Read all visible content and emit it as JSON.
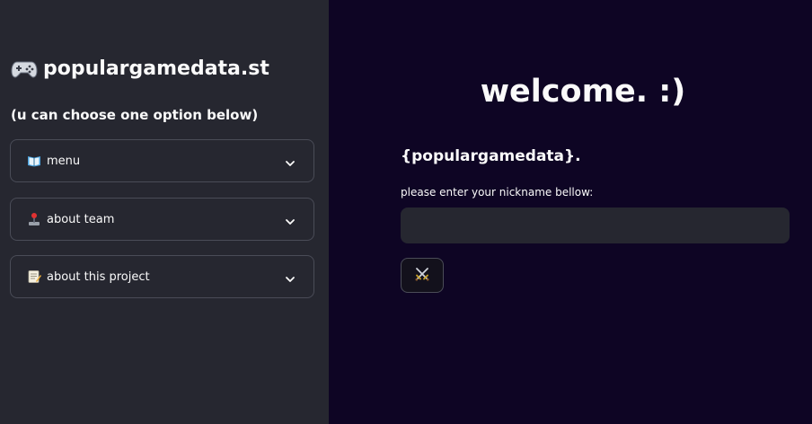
{
  "sidebar": {
    "title": "populargamedata.st",
    "title_icon": "game-controller-icon",
    "subtitle": "(u can choose one option below)",
    "expanders": [
      {
        "label": "menu",
        "icon": "book-icon"
      },
      {
        "label": "about team",
        "icon": "joystick-icon"
      },
      {
        "label": "about this project",
        "icon": "memo-icon"
      }
    ]
  },
  "main": {
    "welcome": "welcome. :)",
    "brand": "{populargamedata}.",
    "nickname_label": "please enter your nickname bellow:",
    "nickname_value": "",
    "submit_icon": "crossed-swords-icon"
  },
  "colors": {
    "sidebar_bg": "#262730",
    "main_bg": "#0e0524",
    "input_bg": "#262730",
    "border": "#4a4c57",
    "text": "#fafafa"
  }
}
